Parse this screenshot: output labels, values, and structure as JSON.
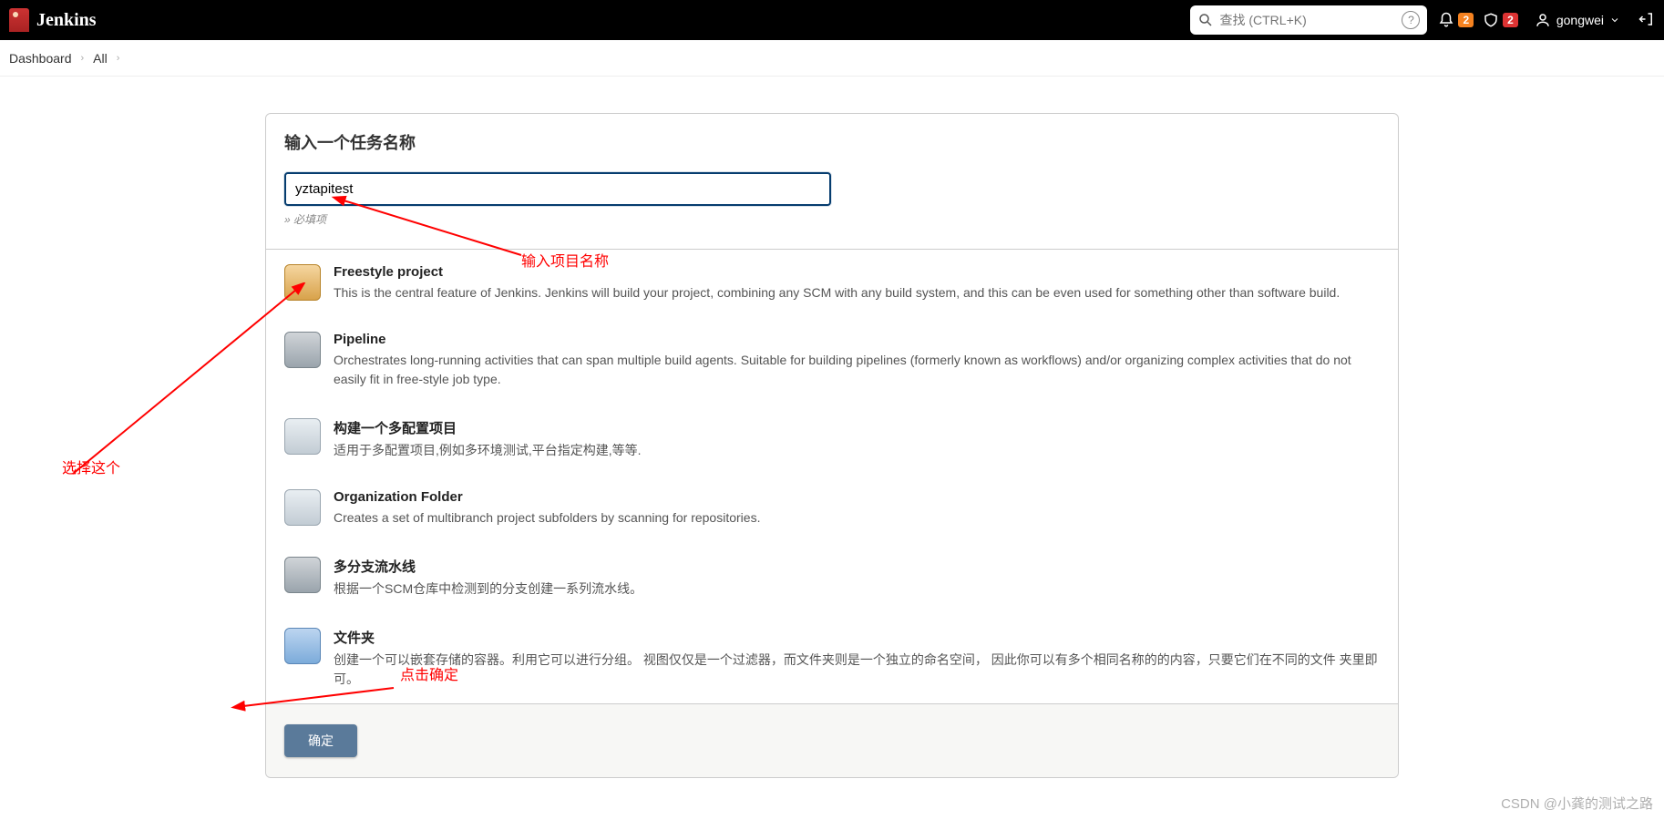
{
  "header": {
    "brand": "Jenkins",
    "search_placeholder": "查找 (CTRL+K)",
    "notif_count": "2",
    "alert_count": "2",
    "username": "gongwei"
  },
  "breadcrumb": {
    "dashboard": "Dashboard",
    "all": "All"
  },
  "form": {
    "title": "输入一个任务名称",
    "name_value": "yztapitest",
    "required_note": "» 必填项"
  },
  "items": [
    {
      "title": "Freestyle project",
      "desc": "This is the central feature of Jenkins. Jenkins will build your project, combining any SCM with any build system, and this can be even used for something other than software build."
    },
    {
      "title": "Pipeline",
      "desc": "Orchestrates long-running activities that can span multiple build agents. Suitable for building pipelines (formerly known as workflows) and/or organizing complex activities that do not easily fit in free-style job type."
    },
    {
      "title": "构建一个多配置项目",
      "desc": "适用于多配置项目,例如多环境测试,平台指定构建,等等."
    },
    {
      "title": "Organization Folder",
      "desc": "Creates a set of multibranch project subfolders by scanning for repositories."
    },
    {
      "title": "多分支流水线",
      "desc": "根据一个SCM仓库中检测到的分支创建一系列流水线。"
    },
    {
      "title": "文件夹",
      "desc": "创建一个可以嵌套存储的容器。利用它可以进行分组。 视图仅仅是一个过滤器，而文件夹则是一个独立的命名空间， 因此你可以有多个相同名称的的内容，只要它们在不同的文件 夹里即可。"
    }
  ],
  "footer": {
    "ok_label": "确定"
  },
  "annotations": {
    "input_label": "输入项目名称",
    "select_label": "选择这个",
    "click_label": "点击确定"
  },
  "watermark": "CSDN @小龚的测试之路"
}
